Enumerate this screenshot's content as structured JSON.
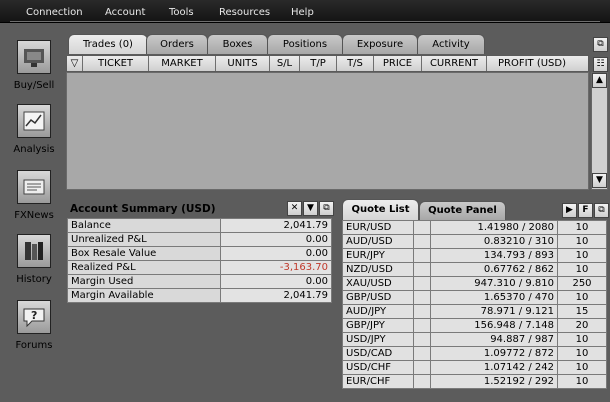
{
  "menu": [
    "Connection",
    "Account",
    "Tools",
    "Resources",
    "Help"
  ],
  "sidebar": [
    {
      "label": "Buy/Sell",
      "icon": "buy-sell-icon"
    },
    {
      "label": "Analysis",
      "icon": "analysis-icon"
    },
    {
      "label": "FXNews",
      "icon": "news-icon"
    },
    {
      "label": "History",
      "icon": "history-icon"
    },
    {
      "label": "Forums",
      "icon": "forums-icon"
    }
  ],
  "trade_tabs": [
    "Trades (0)",
    "Orders",
    "Boxes",
    "Positions",
    "Exposure",
    "Activity"
  ],
  "trade_columns": [
    "▽",
    "TICKET",
    "MARKET",
    "UNITS",
    "S/L",
    "T/P",
    "T/S",
    "PRICE",
    "CURRENT",
    "PROFIT (USD)"
  ],
  "account": {
    "title": "Account Summary (USD)",
    "rows": [
      {
        "label": "Balance",
        "value": "2,041.79",
        "negative": false
      },
      {
        "label": "Unrealized P&L",
        "value": "0.00",
        "negative": false
      },
      {
        "label": "Box Resale Value",
        "value": "0.00",
        "negative": false
      },
      {
        "label": "Realized P&L",
        "value": "-3,163.70",
        "negative": true
      },
      {
        "label": "Margin Used",
        "value": "0.00",
        "negative": false
      },
      {
        "label": "Margin Available",
        "value": "2,041.79",
        "negative": false
      }
    ]
  },
  "quote_tabs": [
    "Quote List",
    "Quote Panel"
  ],
  "quotes": [
    {
      "pair": "EUR/USD",
      "price": "1.41980 / 2080",
      "size": "10"
    },
    {
      "pair": "AUD/USD",
      "price": "0.83210 / 310",
      "size": "10"
    },
    {
      "pair": "EUR/JPY",
      "price": "134.793 / 893",
      "size": "10"
    },
    {
      "pair": "NZD/USD",
      "price": "0.67762 / 862",
      "size": "10"
    },
    {
      "pair": "XAU/USD",
      "price": "947.310 / 9.810",
      "size": "250"
    },
    {
      "pair": "GBP/USD",
      "price": "1.65370 / 470",
      "size": "10"
    },
    {
      "pair": "AUD/JPY",
      "price": "78.971 / 9.121",
      "size": "15"
    },
    {
      "pair": "GBP/JPY",
      "price": "156.948 / 7.148",
      "size": "20"
    },
    {
      "pair": "USD/JPY",
      "price": "94.887 / 987",
      "size": "10"
    },
    {
      "pair": "USD/CAD",
      "price": "1.09772 / 872",
      "size": "10"
    },
    {
      "pair": "USD/CHF",
      "price": "1.07142 / 242",
      "size": "10"
    },
    {
      "pair": "EUR/CHF",
      "price": "1.52192 / 292",
      "size": "10"
    }
  ]
}
